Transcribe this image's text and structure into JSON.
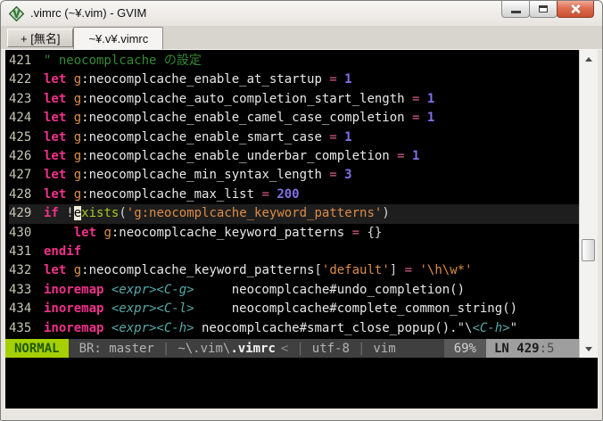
{
  "window": {
    "title": ".vimrc (~¥.vim) - GVIM",
    "app_icon": "vim-logo-icon"
  },
  "tabs": [
    {
      "label": "+ [無名]",
      "active": false
    },
    {
      "label": "~¥.v¥.vimrc",
      "active": true
    }
  ],
  "editor": {
    "cursor_line": 429,
    "cursor_col": 5,
    "lines": [
      {
        "num": "421",
        "segs": [
          {
            "c": "com",
            "t": "\" neocomplcache の設定"
          }
        ]
      },
      {
        "num": "422",
        "segs": [
          {
            "c": "kw",
            "t": "let "
          },
          {
            "c": "scope",
            "t": "g"
          },
          {
            "c": "id",
            "t": ":neocomplcache_enable_at_startup"
          },
          {
            "c": "op",
            "t": " = "
          },
          {
            "c": "num",
            "t": "1"
          }
        ]
      },
      {
        "num": "423",
        "segs": [
          {
            "c": "kw",
            "t": "let "
          },
          {
            "c": "scope",
            "t": "g"
          },
          {
            "c": "id",
            "t": ":neocomplcache_auto_completion_start_length"
          },
          {
            "c": "op",
            "t": " = "
          },
          {
            "c": "num",
            "t": "1"
          }
        ]
      },
      {
        "num": "424",
        "segs": [
          {
            "c": "kw",
            "t": "let "
          },
          {
            "c": "scope",
            "t": "g"
          },
          {
            "c": "id",
            "t": ":neocomplcache_enable_camel_case_completion"
          },
          {
            "c": "op",
            "t": " = "
          },
          {
            "c": "num",
            "t": "1"
          }
        ]
      },
      {
        "num": "425",
        "segs": [
          {
            "c": "kw",
            "t": "let "
          },
          {
            "c": "scope",
            "t": "g"
          },
          {
            "c": "id",
            "t": ":neocomplcache_enable_smart_case"
          },
          {
            "c": "op",
            "t": " = "
          },
          {
            "c": "num",
            "t": "1"
          }
        ]
      },
      {
        "num": "426",
        "segs": [
          {
            "c": "kw",
            "t": "let "
          },
          {
            "c": "scope",
            "t": "g"
          },
          {
            "c": "id",
            "t": ":neocomplcache_enable_underbar_completion"
          },
          {
            "c": "op",
            "t": " = "
          },
          {
            "c": "num",
            "t": "1"
          }
        ]
      },
      {
        "num": "427",
        "segs": [
          {
            "c": "kw",
            "t": "let "
          },
          {
            "c": "scope",
            "t": "g"
          },
          {
            "c": "id",
            "t": ":neocomplcache_min_syntax_length"
          },
          {
            "c": "op",
            "t": " = "
          },
          {
            "c": "num",
            "t": "3"
          }
        ]
      },
      {
        "num": "428",
        "segs": [
          {
            "c": "kw",
            "t": "let "
          },
          {
            "c": "scope",
            "t": "g"
          },
          {
            "c": "id",
            "t": ":neocomplcache_max_list"
          },
          {
            "c": "op",
            "t": " = "
          },
          {
            "c": "num",
            "t": "200"
          }
        ]
      },
      {
        "num": "429",
        "cursorline": true,
        "segs": [
          {
            "c": "kw",
            "t": "if "
          },
          {
            "c": "punct",
            "t": "!"
          },
          {
            "c": "cursor",
            "t": "e"
          },
          {
            "c": "fn",
            "t": "xists"
          },
          {
            "c": "punct",
            "t": "("
          },
          {
            "c": "str",
            "t": "'g:neocomplcache_keyword_patterns'"
          },
          {
            "c": "punct",
            "t": ")"
          }
        ]
      },
      {
        "num": "430",
        "segs": [
          {
            "c": "punct",
            "t": "    "
          },
          {
            "c": "kw",
            "t": "let "
          },
          {
            "c": "scope",
            "t": "g"
          },
          {
            "c": "id",
            "t": ":neocomplcache_keyword_patterns"
          },
          {
            "c": "op",
            "t": " = "
          },
          {
            "c": "punct",
            "t": "{}"
          }
        ]
      },
      {
        "num": "431",
        "segs": [
          {
            "c": "kw",
            "t": "endif"
          }
        ]
      },
      {
        "num": "432",
        "segs": [
          {
            "c": "kw",
            "t": "let "
          },
          {
            "c": "scope",
            "t": "g"
          },
          {
            "c": "id",
            "t": ":neocomplcache_keyword_patterns"
          },
          {
            "c": "punct",
            "t": "["
          },
          {
            "c": "str",
            "t": "'default'"
          },
          {
            "c": "punct",
            "t": "]"
          },
          {
            "c": "op",
            "t": " = "
          },
          {
            "c": "str",
            "t": "'\\h\\w*'"
          }
        ]
      },
      {
        "num": "433",
        "segs": [
          {
            "c": "kw",
            "t": "inoremap "
          },
          {
            "c": "spec",
            "t": "<expr><C-g>"
          },
          {
            "c": "id",
            "t": "     neocomplcache#undo_completion()"
          }
        ]
      },
      {
        "num": "434",
        "segs": [
          {
            "c": "kw",
            "t": "inoremap "
          },
          {
            "c": "spec",
            "t": "<expr><C-l>"
          },
          {
            "c": "id",
            "t": "     neocomplcache#complete_common_string()"
          }
        ]
      },
      {
        "num": "435",
        "segs": [
          {
            "c": "kw",
            "t": "inoremap "
          },
          {
            "c": "spec",
            "t": "<expr><C-h>"
          },
          {
            "c": "id",
            "t": " neocomplcache#smart_close_popup()."
          },
          {
            "c": "punct",
            "t": "\"\\"
          },
          {
            "c": "spec",
            "t": "<C-h>"
          },
          {
            "c": "punct",
            "t": "\""
          }
        ]
      }
    ]
  },
  "statusline": {
    "mode": "NORMAL",
    "branch": "BR: master",
    "sep": "|",
    "path_prefix": "~\\.vim\\",
    "filename": ".vimrc",
    "truncate_marker": "<",
    "encoding": "utf-8",
    "filetype": "vim",
    "scroll_percent": "69%",
    "line_label": "LN 429",
    "column_label": ":5"
  },
  "colors": {
    "mode_bg": "#a6cf00",
    "mode_fg": "#1e5a00",
    "statusline_bg": "#3f3f3f",
    "keyword": "#f0318a",
    "string": "#dd8c46",
    "number": "#8470e8",
    "comment": "#338a33",
    "function": "#a8c81e",
    "special": "#56a8a8",
    "cursorline_bg": "#1e1e1e",
    "close_button": "#cf5640"
  }
}
